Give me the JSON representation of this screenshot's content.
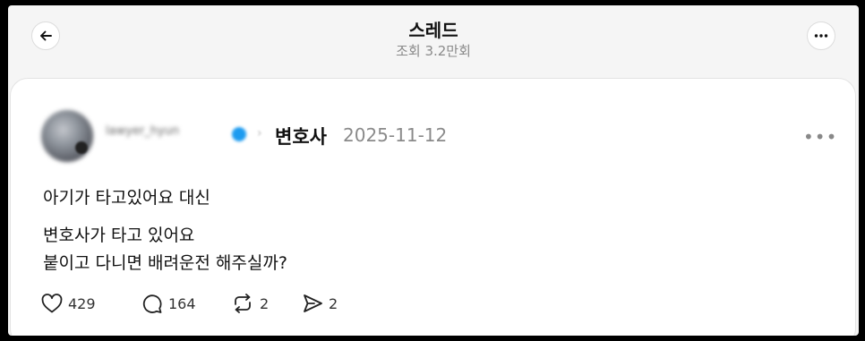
{
  "header": {
    "title": "스레드",
    "views": "조회 3.2만회",
    "back_icon": "arrow-left-icon",
    "more_icon": "more-horizontal-icon"
  },
  "post": {
    "username": "lawyer_hyun",
    "topic": "변호사",
    "date": "2025-11-12",
    "lines": [
      "아기가 타고있어요 대신",
      "변호사가 타고 있어요",
      "붙이고 다니면 배려운전 해주실까?"
    ],
    "stats": {
      "likes": "429",
      "replies": "164",
      "reposts": "2",
      "shares": "2"
    }
  },
  "colors": {
    "background": "#f5f5f5",
    "card": "#ffffff",
    "muted_text": "#8a8a8a",
    "verified": "#1d9bf0"
  }
}
